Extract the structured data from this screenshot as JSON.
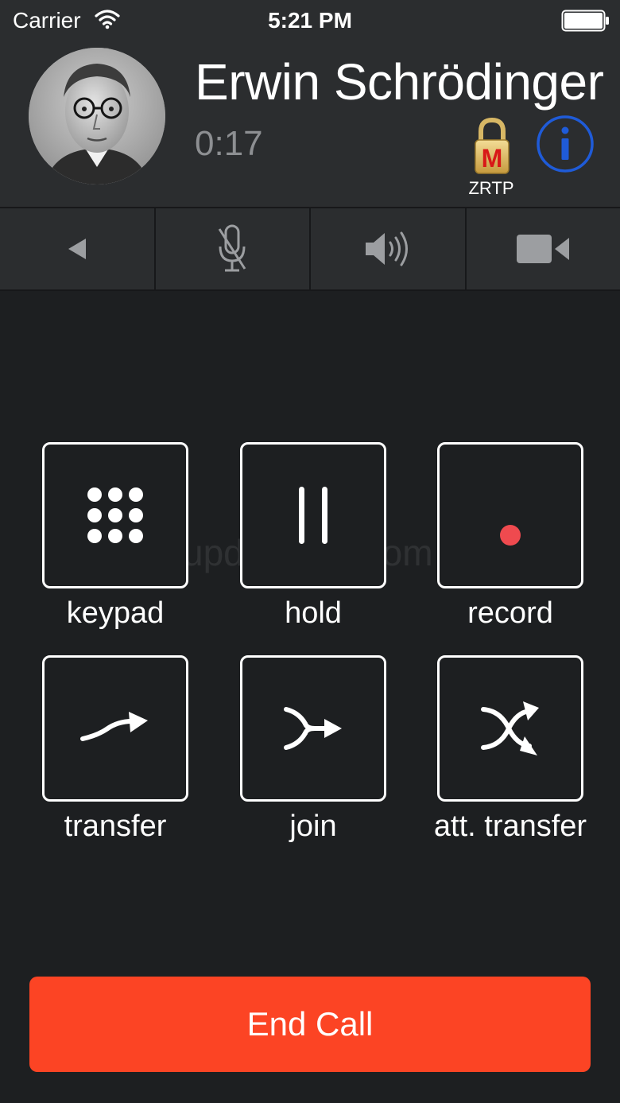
{
  "status_bar": {
    "carrier": "Carrier",
    "time": "5:21 PM"
  },
  "call": {
    "contact_name": "Erwin Schrödinger",
    "duration": "0:17",
    "security_label": "ZRTP",
    "security_lock_letter": "M"
  },
  "controls": [
    {
      "name": "back",
      "icon": "triangle-left-icon"
    },
    {
      "name": "mute",
      "icon": "microphone-muted-icon"
    },
    {
      "name": "speaker",
      "icon": "speaker-icon"
    },
    {
      "name": "video",
      "icon": "video-camera-icon"
    }
  ],
  "actions": {
    "keypad": "keypad",
    "hold": "hold",
    "record": "record",
    "transfer": "transfer",
    "join": "join",
    "att_transfer": "att. transfer"
  },
  "end_call": {
    "label": "End Call"
  },
  "watermark": "updatestar.com",
  "colors": {
    "background": "#1d1f21",
    "header": "#2b2d2f",
    "end_call": "#fc4424",
    "record_dot": "#ef4a4f",
    "info_blue": "#1f5bd8",
    "muted_text": "#8d8f92"
  }
}
